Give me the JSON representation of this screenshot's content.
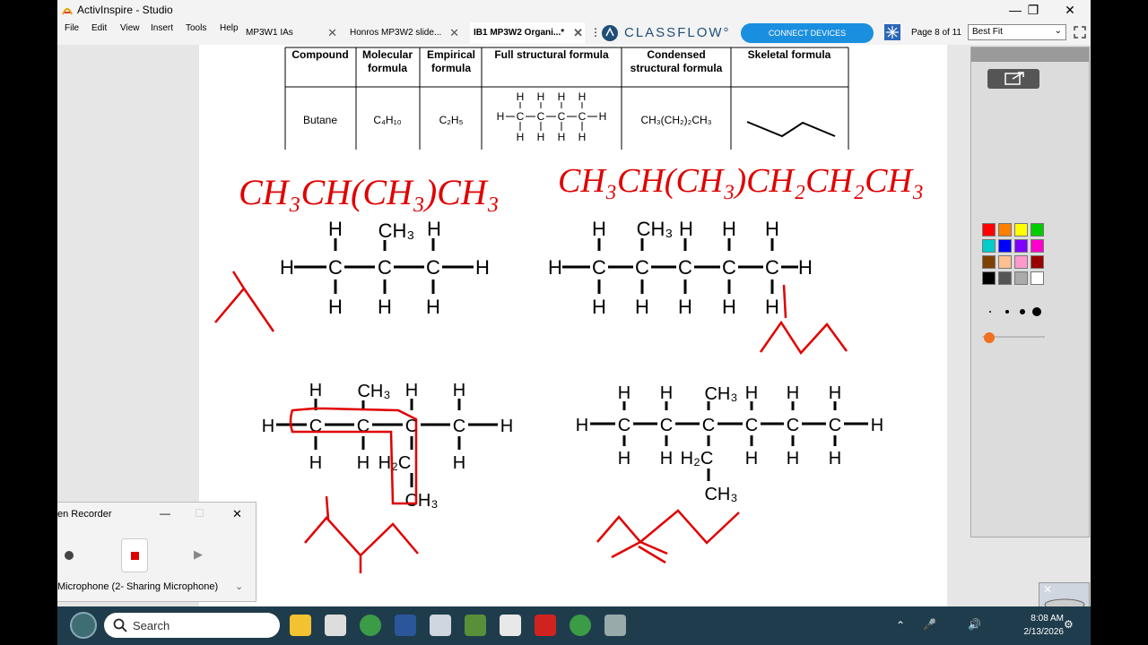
{
  "window": {
    "title": "ActivInspire - Studio",
    "min": "—",
    "max": "❐",
    "close": "✕"
  },
  "menu": [
    "File",
    "Edit",
    "View",
    "Insert",
    "Tools",
    "Help"
  ],
  "tabs": [
    {
      "label": "MP3W1 IAs"
    },
    {
      "label": "Honros MP3W2 slide..."
    },
    {
      "label": "IB1 MP3W2 Organi...*"
    }
  ],
  "tabs_more": "⋮",
  "classflow": {
    "logo": "CLASSFLOW°",
    "connect_label": "CONNECT DEVICES"
  },
  "page_indicator": "Page 8 of 11",
  "zoom": {
    "value": "Best Fit"
  },
  "table": {
    "headers": [
      "Compound",
      "Molecular formula",
      "Empirical formula",
      "Full structural formula",
      "Condensed structural formula",
      "Skeletal formula"
    ],
    "row": {
      "compound": "Butane",
      "molecular": "C₄H₁₀",
      "empirical": "C₂H₅",
      "condensed": "CH₃(CH₂)₂CH₃"
    }
  },
  "handwriting": {
    "left_formula": "CH₃CH(CH₃)CH₃",
    "right_formula": "CH₃CH(CH₃)CH₂CH₂CH₃"
  },
  "structures": {
    "H": "H",
    "C": "C",
    "CH3": "CH₃",
    "H2C": "H₂C",
    "CH3_lower": "CH₃"
  },
  "recorder": {
    "title": "en Recorder",
    "min": "—",
    "max": "☐",
    "close": "✕",
    "mic_label": "Microphone (2- Sharing Microphone)"
  },
  "taskbar": {
    "search_placeholder": "Search",
    "time": "8:08 AM",
    "date": "2/13/2026"
  },
  "colors": {
    "ink": "#e00000",
    "accent": "#1a8fe0",
    "taskbar": "#1f3c4c"
  },
  "palette": [
    "#ff0000",
    "#ff8000",
    "#ffff00",
    "#00cc00",
    "#00cccc",
    "#0000ff",
    "#8000ff",
    "#ff00cc",
    "#804000",
    "#ffc090",
    "#ff99cc",
    "#990000",
    "#000000",
    "#555555",
    "#aaaaaa",
    "#ffffff"
  ]
}
